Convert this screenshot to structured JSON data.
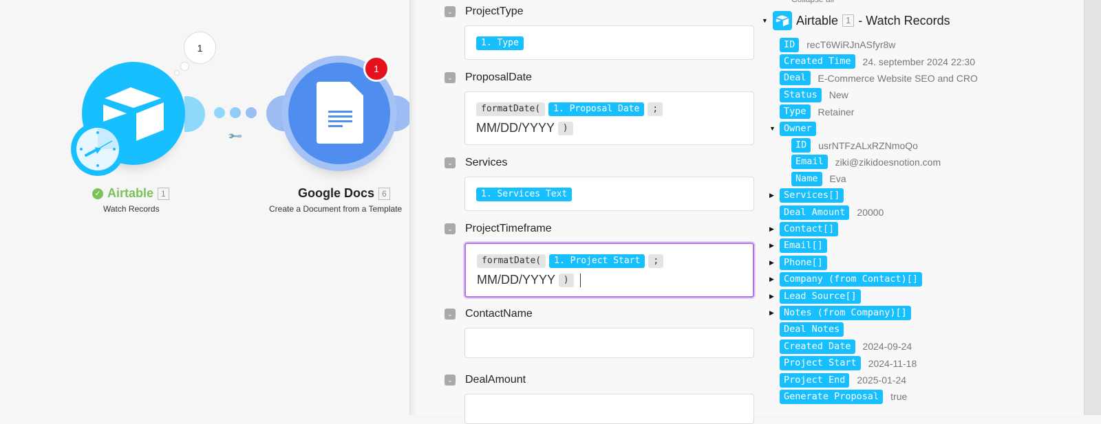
{
  "canvas": {
    "airtable_node": {
      "title": "Airtable",
      "count": "1",
      "subtitle": "Watch Records",
      "bubble_count": "1",
      "status": "success"
    },
    "google_docs_node": {
      "title": "Google Docs",
      "count": "6",
      "subtitle": "Create a Document from a Template",
      "error_badge": "1"
    },
    "colors": {
      "airtable": "#18bfff",
      "google_docs": "#4f8def",
      "error": "#e5111c",
      "success": "#79c35a"
    }
  },
  "form": {
    "fields": [
      {
        "label": "ProjectType",
        "tokens": [
          {
            "type": "var",
            "text": "1. Type"
          }
        ]
      },
      {
        "label": "ProposalDate",
        "tokens": [
          {
            "type": "fn",
            "text": "formatDate("
          },
          {
            "type": "var",
            "text": "1. Proposal Date"
          },
          {
            "type": "fn",
            "text": ";"
          },
          {
            "type": "text",
            "text": "MM/DD/YYYY"
          },
          {
            "type": "fn",
            "text": ")"
          }
        ]
      },
      {
        "label": "Services",
        "tokens": [
          {
            "type": "var",
            "text": "1. Services Text"
          }
        ]
      },
      {
        "label": "ProjectTimeframe",
        "focused": true,
        "tokens": [
          {
            "type": "fn",
            "text": "formatDate("
          },
          {
            "type": "var",
            "text": "1. Project Start"
          },
          {
            "type": "fn",
            "text": ";"
          },
          {
            "type": "text",
            "text": "MM/DD/YYYY"
          },
          {
            "type": "fn",
            "text": ")"
          }
        ]
      },
      {
        "label": "ContactName",
        "tokens": []
      },
      {
        "label": "DealAmount",
        "tokens": []
      }
    ]
  },
  "mapper": {
    "collapse_all": "Collapse all",
    "module_name": "Airtable",
    "module_count": "1",
    "module_suffix": "- Watch Records",
    "items": [
      {
        "key": "ID",
        "value": "recT6WiRJnASfyr8w"
      },
      {
        "key": "Created Time",
        "value": "24. september 2024 22:30"
      },
      {
        "key": "Deal",
        "value": "E-Commerce Website SEO and CRO"
      },
      {
        "key": "Status",
        "value": "New"
      },
      {
        "key": "Type",
        "value": "Retainer"
      },
      {
        "key": "Owner",
        "value": "",
        "toggle": "expanded"
      },
      {
        "key": "ID",
        "value": "usrNTFzALxRZNmoQo",
        "indent": 1
      },
      {
        "key": "Email",
        "value": "ziki@zikidoesnotion.com",
        "indent": 1
      },
      {
        "key": "Name",
        "value": "Eva",
        "indent": 1
      },
      {
        "key": "Services[]",
        "value": "",
        "toggle": "collapsed"
      },
      {
        "key": "Deal Amount",
        "value": "20000"
      },
      {
        "key": "Contact[]",
        "value": "",
        "toggle": "collapsed"
      },
      {
        "key": "Email[]",
        "value": "",
        "toggle": "collapsed"
      },
      {
        "key": "Phone[]",
        "value": "",
        "toggle": "collapsed"
      },
      {
        "key": "Company (from Contact)[]",
        "value": "",
        "toggle": "collapsed"
      },
      {
        "key": "Lead Source[]",
        "value": "",
        "toggle": "collapsed"
      },
      {
        "key": "Notes (from Company)[]",
        "value": "",
        "toggle": "collapsed"
      },
      {
        "key": "Deal Notes",
        "value": ""
      },
      {
        "key": "Created Date",
        "value": "2024-09-24"
      },
      {
        "key": "Project Start",
        "value": "2024-11-18"
      },
      {
        "key": "Project End",
        "value": "2025-01-24"
      },
      {
        "key": "Generate Proposal",
        "value": "true"
      }
    ]
  }
}
